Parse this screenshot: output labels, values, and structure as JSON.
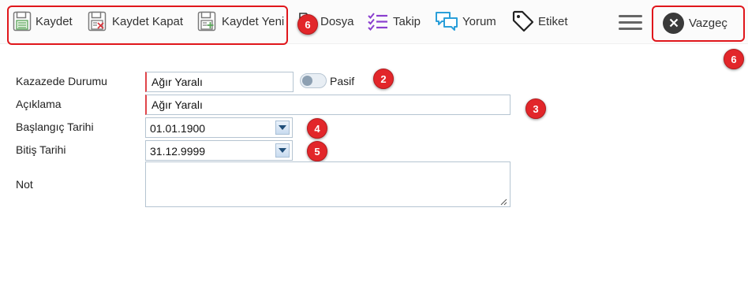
{
  "toolbar": {
    "save_label": "Kaydet",
    "save_close_label": "Kaydet Kapat",
    "save_new_label": "Kaydet Yeni",
    "file_label": "Dosya",
    "follow_label": "Takip",
    "comment_label": "Yorum",
    "tag_label": "Etiket",
    "cancel_label": "Vazgeç"
  },
  "badges": {
    "toolbar_group": "6",
    "cancel": "6",
    "status": "2",
    "description": "3",
    "start_date": "4",
    "end_date": "5"
  },
  "form": {
    "status_label": "Kazazede Durumu",
    "status_value": "Ağır Yaralı",
    "passive_label": "Pasif",
    "passive_on": false,
    "description_label": "Açıklama",
    "description_value": "Ağır Yaralı",
    "start_date_label": "Başlangıç Tarihi",
    "start_date_value": "01.01.1900",
    "end_date_label": "Bitiş Tarihi",
    "end_date_value": "31.12.9999",
    "note_label": "Not",
    "note_value": ""
  },
  "colors": {
    "highlight": "#e0161b",
    "badge": "#e2262a",
    "save_icon": "#5aa55a",
    "cancel_icon_x": "#d9363e",
    "follow_icon": "#8a3fcf",
    "comment_icon": "#2b9fd9",
    "required_marker": "#e0454a"
  },
  "icons": {
    "save": "floppy-disk-icon",
    "save_close": "floppy-disk-x-icon",
    "save_new": "floppy-disk-plus-icon",
    "file": "file-icon",
    "follow": "checklist-icon",
    "comment": "chat-bubbles-icon",
    "tag": "tag-icon",
    "menu": "hamburger-icon",
    "cancel": "close-circle-icon"
  }
}
